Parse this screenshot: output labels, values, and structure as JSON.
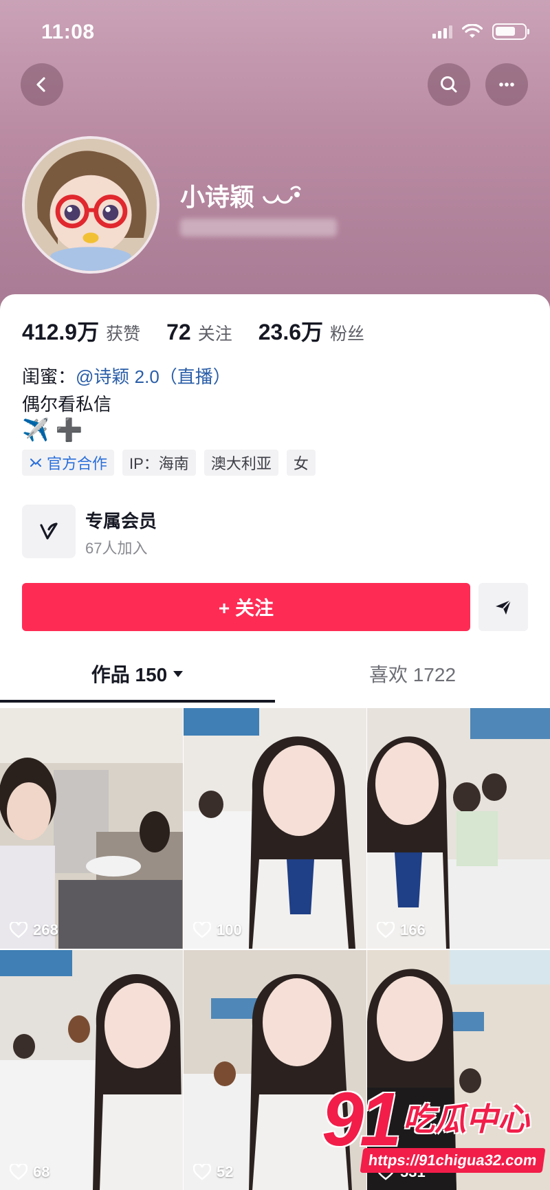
{
  "status_bar": {
    "time": "11:08"
  },
  "profile": {
    "name": "小诗颖",
    "stats": [
      {
        "value": "412.9万",
        "label": "获赞"
      },
      {
        "value": "72",
        "label": "关注"
      },
      {
        "value": "23.6万",
        "label": "粉丝"
      }
    ],
    "bio": {
      "line1_prefix": "闺蜜：",
      "line1_mention": "@诗颖 2.0（直播）",
      "line2": "偶尔看私信",
      "line3": "✈️ ➕"
    },
    "tags": [
      {
        "label": "官方合作",
        "icon": "official-icon"
      },
      {
        "label": "IP：海南"
      },
      {
        "label": "澳大利亚"
      },
      {
        "label": "女"
      }
    ],
    "member": {
      "title": "专属会员",
      "subtitle": "67人加入"
    },
    "follow_label": "+ 关注"
  },
  "tabs": {
    "works": "作品 150",
    "likes": "喜欢 1722"
  },
  "videos": [
    {
      "likes": "268"
    },
    {
      "likes": "100"
    },
    {
      "likes": "166"
    },
    {
      "likes": "68"
    },
    {
      "likes": "52"
    },
    {
      "likes": "531"
    }
  ],
  "watermark": {
    "big": "91",
    "text": "吃瓜中心",
    "url": "https://91chigua32.com"
  },
  "colors": {
    "accent": "#fe2c55",
    "mention": "#2a5ea8",
    "header_bg": "#b98aa2"
  }
}
